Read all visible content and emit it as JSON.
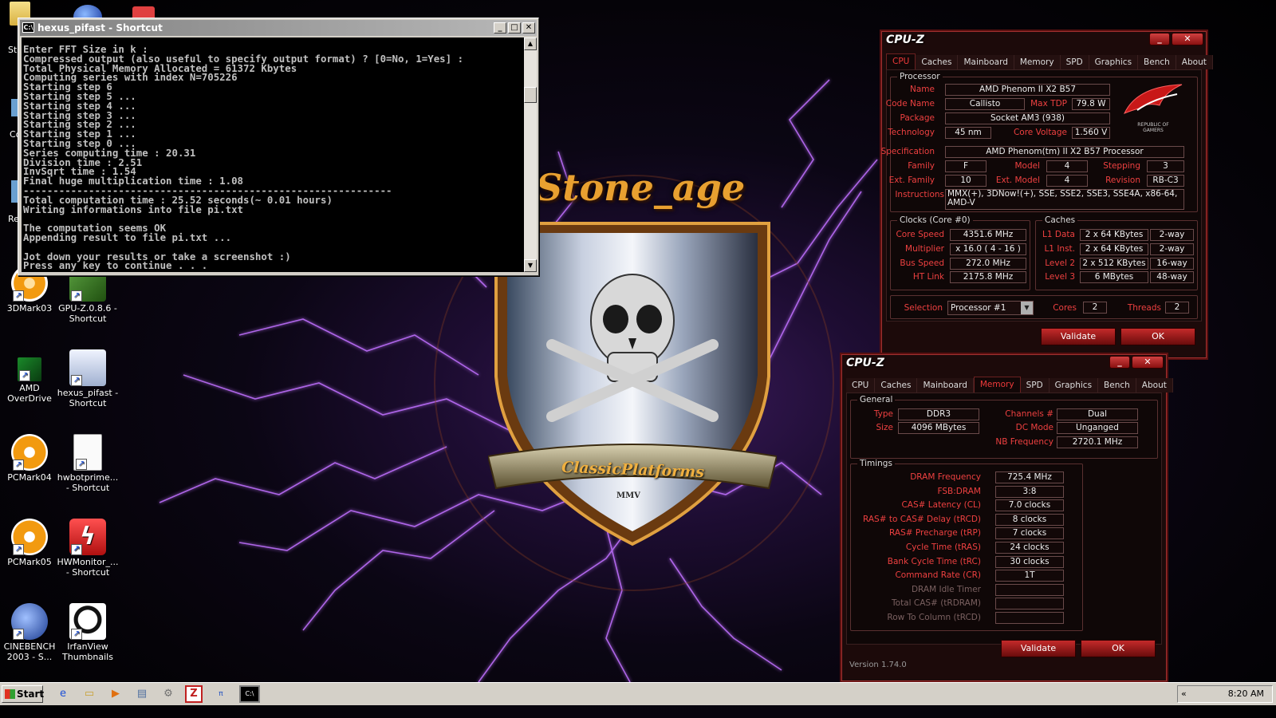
{
  "wallpaper": {
    "title": "Stone_age",
    "banner": "ClassicPlatforms",
    "banner_small": "MMV"
  },
  "desktop": {
    "partial_labels": [
      "St",
      "Co",
      "Re"
    ],
    "icons": [
      {
        "label": "3DMark03",
        "icon": "3dmark-icon"
      },
      {
        "label": "GPU-Z.0.8.6 - Shortcut",
        "icon": "gpuz-icon"
      },
      {
        "label": "AMD OverDrive",
        "icon": "amd-overdrive-icon"
      },
      {
        "label": "hexus_pifast - Shortcut",
        "icon": "pifast-icon"
      },
      {
        "label": "PCMark04",
        "icon": "pcmark04-icon"
      },
      {
        "label": "hwbotprime... - Shortcut",
        "icon": "java-icon"
      },
      {
        "label": "PCMark05",
        "icon": "pcmark05-icon"
      },
      {
        "label": "HWMonitor_... - Shortcut",
        "icon": "hwmonitor-icon"
      },
      {
        "label": "CINEBENCH 2003 - S...",
        "icon": "cinebench-icon"
      },
      {
        "label": "IrfanView Thumbnails",
        "icon": "irfanview-icon"
      }
    ]
  },
  "console": {
    "title": "hexus_pifast - Shortcut",
    "lines": [
      "Enter FFT Size in k :",
      "Compressed output (also useful to specify output format) ? [0=No, 1=Yes] :",
      "Total Physical Memory Allocated = 61372 Kbytes",
      "Computing series with index N=705226",
      "Starting step 6",
      "Starting step 5 ...",
      "Starting step 4 ...",
      "Starting step 3 ...",
      "Starting step 2 ...",
      "Starting step 1 ...",
      "Starting step 0 ...",
      "Series computing time : 20.31",
      "Division time : 2.51",
      "InvSqrt time : 1.54",
      "Final huge multiplication time : 1.08",
      "--------------------------------------------------------------",
      "Total computation time : 25.52 seconds(~ 0.01 hours)",
      "Writing informations into file pi.txt",
      "",
      "The computation seems OK",
      "Appending result to file pi.txt ...",
      "",
      "Jot down your results or take a screenshot :)",
      "Press any key to continue . . ."
    ]
  },
  "cpuz_cpu": {
    "title": "CPU-Z",
    "tabs": [
      "CPU",
      "Caches",
      "Mainboard",
      "Memory",
      "SPD",
      "Graphics",
      "Bench",
      "About"
    ],
    "active_tab": "CPU",
    "processor_group": "Processor",
    "name_label": "Name",
    "name": "AMD Phenom II X2 B57",
    "codename_label": "Code Name",
    "codename": "Callisto",
    "maxtdp_label": "Max TDP",
    "maxtdp": "79.8 W",
    "package_label": "Package",
    "package": "Socket AM3 (938)",
    "technology_label": "Technology",
    "technology": "45 nm",
    "corevoltage_label": "Core Voltage",
    "corevoltage": "1.560 V",
    "logo_text": "REPUBLIC OF GAMERS",
    "spec_label": "Specification",
    "spec": "AMD Phenom(tm) II X2 B57 Processor",
    "family_label": "Family",
    "family": "F",
    "model_label": "Model",
    "model": "4",
    "stepping_label": "Stepping",
    "stepping": "3",
    "extfamily_label": "Ext. Family",
    "extfamily": "10",
    "extmodel_label": "Ext. Model",
    "extmodel": "4",
    "revision_label": "Revision",
    "revision": "RB-C3",
    "instructions_label": "Instructions",
    "instructions": "MMX(+), 3DNow!(+), SSE, SSE2, SSE3, SSE4A, x86-64, AMD-V",
    "clocks_group": "Clocks (Core #0)",
    "corespeed_label": "Core Speed",
    "corespeed": "4351.6 MHz",
    "multiplier_label": "Multiplier",
    "multiplier": "x 16.0 ( 4 - 16 )",
    "busspeed_label": "Bus Speed",
    "busspeed": "272.0 MHz",
    "htlink_label": "HT Link",
    "htlink": "2175.8 MHz",
    "caches_group": "Caches",
    "l1data_label": "L1 Data",
    "l1data": "2 x 64 KBytes",
    "l1data_way": "2-way",
    "l1inst_label": "L1 Inst.",
    "l1inst": "2 x 64 KBytes",
    "l1inst_way": "2-way",
    "level2_label": "Level 2",
    "level2": "2 x 512 KBytes",
    "level2_way": "16-way",
    "level3_label": "Level 3",
    "level3": "6 MBytes",
    "level3_way": "48-way",
    "selection_label": "Selection",
    "selection": "Processor #1",
    "cores_label": "Cores",
    "cores": "2",
    "threads_label": "Threads",
    "threads": "2",
    "validate": "Validate",
    "ok": "OK"
  },
  "cpuz_mem": {
    "title": "CPU-Z",
    "tabs": [
      "CPU",
      "Caches",
      "Mainboard",
      "Memory",
      "SPD",
      "Graphics",
      "Bench",
      "About"
    ],
    "active_tab": "Memory",
    "general_group": "General",
    "type_label": "Type",
    "type": "DDR3",
    "size_label": "Size",
    "size": "4096 MBytes",
    "channels_label": "Channels #",
    "channels": "Dual",
    "dcmode_label": "DC Mode",
    "dcmode": "Unganged",
    "nbfreq_label": "NB Frequency",
    "nbfreq": "2720.1 MHz",
    "timings_group": "Timings",
    "timings": [
      {
        "label": "DRAM Frequency",
        "value": "725.4 MHz",
        "dim": false
      },
      {
        "label": "FSB:DRAM",
        "value": "3:8",
        "dim": false
      },
      {
        "label": "CAS# Latency (CL)",
        "value": "7.0 clocks",
        "dim": false
      },
      {
        "label": "RAS# to CAS# Delay (tRCD)",
        "value": "8 clocks",
        "dim": false
      },
      {
        "label": "RAS# Precharge (tRP)",
        "value": "7 clocks",
        "dim": false
      },
      {
        "label": "Cycle Time (tRAS)",
        "value": "24 clocks",
        "dim": false
      },
      {
        "label": "Bank Cycle Time (tRC)",
        "value": "30 clocks",
        "dim": false
      },
      {
        "label": "Command Rate (CR)",
        "value": "1T",
        "dim": false
      },
      {
        "label": "DRAM Idle Timer",
        "value": "",
        "dim": true
      },
      {
        "label": "Total CAS# (tRDRAM)",
        "value": "",
        "dim": true
      },
      {
        "label": "Row To Column (tRCD)",
        "value": "",
        "dim": true
      }
    ],
    "validate": "Validate",
    "ok": "OK",
    "version": "Version 1.74.0"
  },
  "taskbar": {
    "start": "Start",
    "clock": "8:20 AM",
    "tray_arrow": "«"
  }
}
